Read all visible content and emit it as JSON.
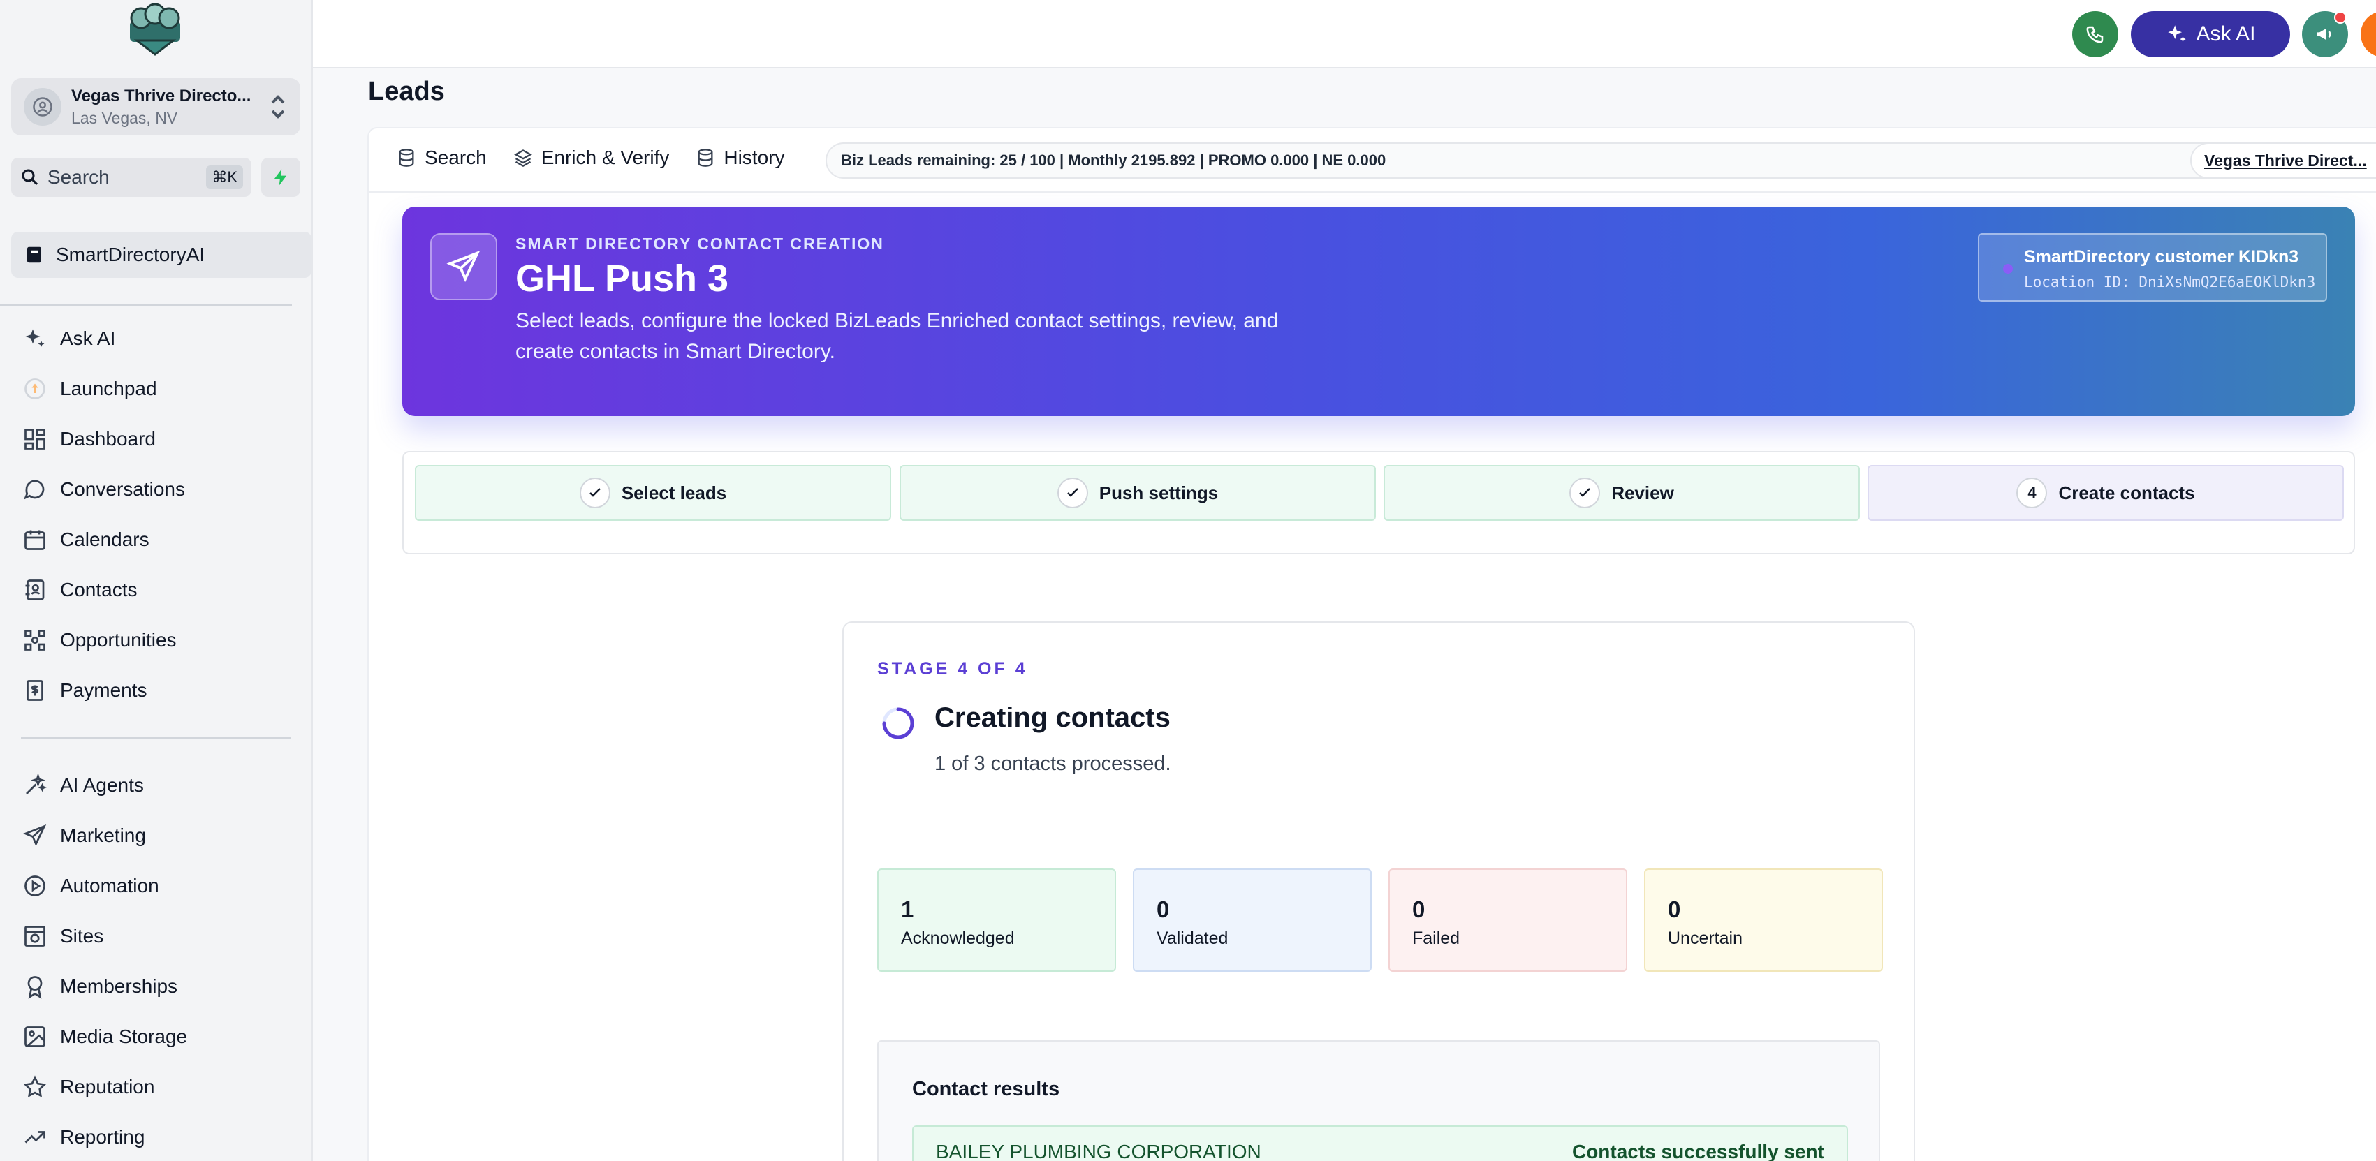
{
  "sidebar": {
    "account": {
      "name": "Vegas Thrive Directo...",
      "location": "Las Vegas, NV"
    },
    "search": {
      "label": "Search",
      "shortcut": "⌘K"
    },
    "active_item": "SmartDirectoryAI",
    "items_group1": [
      {
        "label": "Ask AI",
        "icon": "sparkle-icon"
      },
      {
        "label": "Launchpad",
        "icon": "rocket-icon"
      },
      {
        "label": "Dashboard",
        "icon": "grid-icon"
      },
      {
        "label": "Conversations",
        "icon": "chat-icon"
      },
      {
        "label": "Calendars",
        "icon": "calendar-icon"
      },
      {
        "label": "Contacts",
        "icon": "contacts-icon"
      },
      {
        "label": "Opportunities",
        "icon": "opportunities-icon"
      },
      {
        "label": "Payments",
        "icon": "payments-icon"
      }
    ],
    "items_group2": [
      {
        "label": "AI Agents",
        "icon": "ai-agents-icon"
      },
      {
        "label": "Marketing",
        "icon": "send-icon"
      },
      {
        "label": "Automation",
        "icon": "automation-icon"
      },
      {
        "label": "Sites",
        "icon": "sites-icon"
      },
      {
        "label": "Memberships",
        "icon": "award-icon"
      },
      {
        "label": "Media Storage",
        "icon": "image-icon"
      },
      {
        "label": "Reputation",
        "icon": "star-icon"
      },
      {
        "label": "Reporting",
        "icon": "trend-icon"
      }
    ]
  },
  "topbar": {
    "ask_ai_label": "Ask AI"
  },
  "page": {
    "title": "Leads",
    "tabs": [
      {
        "label": "Search",
        "icon": "database-icon"
      },
      {
        "label": "Enrich & Verify",
        "icon": "layers-icon"
      },
      {
        "label": "History",
        "icon": "database-icon"
      }
    ],
    "status_text": "Biz Leads remaining: 25 / 100 | Monthly 2195.892 | PROMO 0.000 | NE 0.000",
    "location_link": "Vegas Thrive Direct..."
  },
  "hero": {
    "eyebrow": "SMART DIRECTORY CONTACT CREATION",
    "title": "GHL Push 3",
    "description": "Select leads, configure the locked BizLeads Enriched contact settings, review, and create contacts in Smart Directory.",
    "badge_title": "SmartDirectory customer KIDkn3",
    "badge_sub": "Location ID: DniXsNmQ2E6aEOKlDkn3"
  },
  "stepper": {
    "steps": [
      {
        "label": "Select leads",
        "state": "done"
      },
      {
        "label": "Push settings",
        "state": "done"
      },
      {
        "label": "Review",
        "state": "done"
      },
      {
        "label": "Create contacts",
        "state": "active",
        "number": "4"
      }
    ]
  },
  "panel": {
    "stage_label": "STAGE 4 OF 4",
    "title": "Creating contacts",
    "processed_text": "1 of 3 contacts processed.",
    "stats": [
      {
        "value": "1",
        "label": "Acknowledged"
      },
      {
        "value": "0",
        "label": "Validated"
      },
      {
        "value": "0",
        "label": "Failed"
      },
      {
        "value": "0",
        "label": "Uncertain"
      }
    ],
    "results_title": "Contact results",
    "results": [
      {
        "name": "BAILEY PLUMBING CORPORATION",
        "status": "Contacts successfully sent"
      }
    ]
  },
  "colors": {
    "accent": "#5b3fd4",
    "ask_ai": "#3730a3",
    "phone": "#2f8a4f",
    "bell": "#f97316",
    "success_bg": "#ecfaf2"
  }
}
